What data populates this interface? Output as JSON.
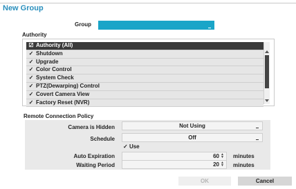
{
  "dialog": {
    "title": "New Group"
  },
  "group": {
    "label": "Group",
    "value": ""
  },
  "authority": {
    "section_label": "Authority",
    "items": [
      {
        "label": "Authority (All)",
        "checked": true,
        "selected": true
      },
      {
        "label": "Shutdown",
        "checked": true,
        "selected": false
      },
      {
        "label": "Upgrade",
        "checked": true,
        "selected": false
      },
      {
        "label": "Color Control",
        "checked": true,
        "selected": false
      },
      {
        "label": "System Check",
        "checked": true,
        "selected": false
      },
      {
        "label": "PTZ(Dewarping) Control",
        "checked": true,
        "selected": false
      },
      {
        "label": "Covert Camera View",
        "checked": true,
        "selected": false
      },
      {
        "label": "Factory Reset (NVR)",
        "checked": true,
        "selected": false
      }
    ]
  },
  "remote": {
    "section_label": "Remote Connection Policy",
    "camera_hidden_label": "Camera is Hidden",
    "camera_hidden_value": "Not Using",
    "schedule_label": "Schedule",
    "schedule_value": "Off",
    "use_label": "Use",
    "use_checked": true,
    "auto_expiration_label": "Auto Expiration",
    "auto_expiration_value": "60",
    "auto_expiration_unit": "minutes",
    "waiting_period_label": "Waiting Period",
    "waiting_period_value": "20",
    "waiting_period_unit": "minutes"
  },
  "buttons": {
    "ok": "OK",
    "cancel": "Cancel"
  },
  "colors": {
    "accent": "#2a8fbd",
    "group_field": "#1aa5c8",
    "selected_row": "#3a3a3a"
  }
}
